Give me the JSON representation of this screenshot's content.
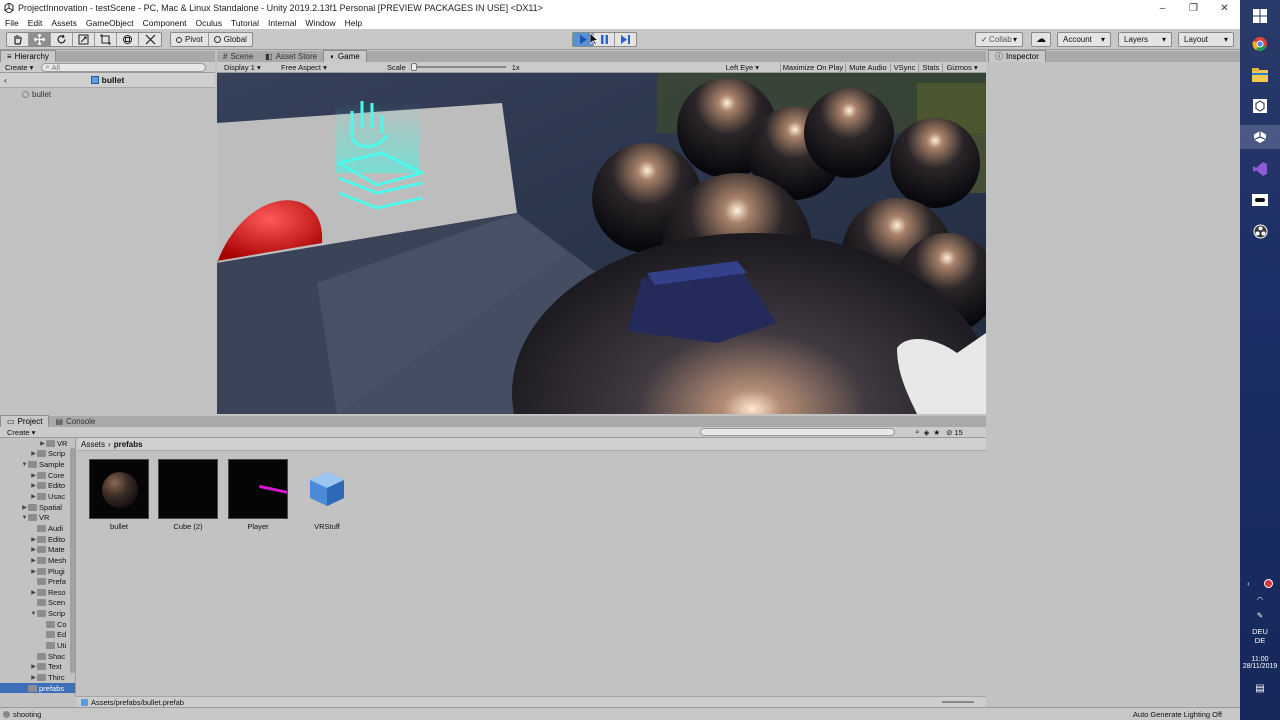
{
  "window": {
    "title": "ProjectInnovation - testScene - PC, Mac & Linux Standalone - Unity 2019.2.13f1 Personal [PREVIEW PACKAGES IN USE] <DX11>",
    "min_glyph": "–",
    "max_glyph": "❐",
    "close_glyph": "✕"
  },
  "menu": [
    "File",
    "Edit",
    "Assets",
    "GameObject",
    "Component",
    "Oculus",
    "Tutorial",
    "Internal",
    "Window",
    "Help"
  ],
  "toolbar": {
    "pivot_label": "Pivot",
    "global_label": "Global",
    "collab_label": "Collab",
    "account_label": "Account",
    "layers_label": "Layers",
    "layout_label": "Layout",
    "dropdown_glyph": "▾",
    "cloud_glyph": "☁"
  },
  "hierarchy": {
    "tab_label": "Hierarchy",
    "create_label": "Create",
    "search_placeholder": "All",
    "scene_title": "bullet",
    "items": [
      "bullet"
    ]
  },
  "scene_tabs": {
    "scene_label": "Scene",
    "asset_store_label": "Asset Store",
    "game_label": "Game"
  },
  "game_bar": {
    "display": "Display 1",
    "aspect": "Free Aspect",
    "scale_label": "Scale",
    "scale_value": "1x",
    "eye": "Left Eye",
    "maximize": "Maximize On Play",
    "mute": "Mute Audio",
    "vsync": "VSync",
    "stats": "Stats",
    "gizmos": "Gizmos"
  },
  "inspector": {
    "tab_label": "Inspector"
  },
  "project": {
    "project_tab": "Project",
    "console_tab": "Console",
    "create_label": "Create",
    "breadcrumb_root": "Assets",
    "breadcrumb_sep": "›",
    "breadcrumb_current": "prefabs",
    "count_label": "15",
    "tree": [
      {
        "label": "VR",
        "indent": 3,
        "arrow": "▶"
      },
      {
        "label": "Scrip",
        "indent": 2,
        "arrow": "▶"
      },
      {
        "label": "Sample",
        "indent": 1,
        "arrow": "▼"
      },
      {
        "label": "Core",
        "indent": 2,
        "arrow": "▶"
      },
      {
        "label": "Edito",
        "indent": 2,
        "arrow": "▶"
      },
      {
        "label": "Usac",
        "indent": 2,
        "arrow": "▶"
      },
      {
        "label": "Spatial",
        "indent": 1,
        "arrow": "▶"
      },
      {
        "label": "VR",
        "indent": 1,
        "arrow": "▼"
      },
      {
        "label": "Audi",
        "indent": 2,
        "arrow": ""
      },
      {
        "label": "Edito",
        "indent": 2,
        "arrow": "▶"
      },
      {
        "label": "Mate",
        "indent": 2,
        "arrow": "▶"
      },
      {
        "label": "Mesh",
        "indent": 2,
        "arrow": "▶"
      },
      {
        "label": "Plugi",
        "indent": 2,
        "arrow": "▶"
      },
      {
        "label": "Prefa",
        "indent": 2,
        "arrow": ""
      },
      {
        "label": "Reso",
        "indent": 2,
        "arrow": "▶"
      },
      {
        "label": "Scen",
        "indent": 2,
        "arrow": ""
      },
      {
        "label": "Scrip",
        "indent": 2,
        "arrow": "▼"
      },
      {
        "label": "Co",
        "indent": 3,
        "arrow": ""
      },
      {
        "label": "Ed",
        "indent": 3,
        "arrow": ""
      },
      {
        "label": "Uti",
        "indent": 3,
        "arrow": ""
      },
      {
        "label": "Shac",
        "indent": 2,
        "arrow": ""
      },
      {
        "label": "Text",
        "indent": 2,
        "arrow": "▶"
      },
      {
        "label": "Thirc",
        "indent": 2,
        "arrow": "▶"
      },
      {
        "label": "prefabs",
        "indent": 1,
        "arrow": "",
        "selected": true
      }
    ],
    "assets": [
      {
        "label": "bullet",
        "kind": "sphere"
      },
      {
        "label": "Cube (2)",
        "kind": "dark"
      },
      {
        "label": "Player",
        "kind": "player"
      },
      {
        "label": "VRStuff",
        "kind": "cube"
      }
    ],
    "selected_path": "Assets/prefabs/bullet.prefab"
  },
  "status": {
    "left": "shooting",
    "right": "Auto Generate Lighting Off"
  },
  "taskbar": {
    "lang_top": "DEU",
    "lang_bottom": "DE",
    "time": "11:00",
    "date": "28/11/2019"
  }
}
